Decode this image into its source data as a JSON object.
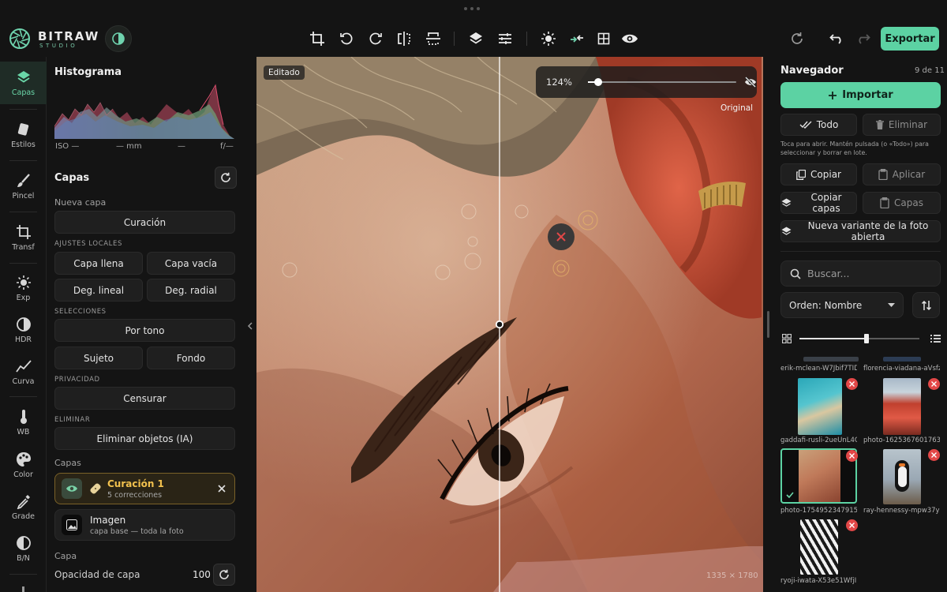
{
  "brand": {
    "name": "BITRAW",
    "sub": "STUDIO"
  },
  "toolbar": {
    "export_label": "Exportar",
    "tools": [
      "crop-icon",
      "rotate-left-icon",
      "rotate-right-icon",
      "flip-horizontal-icon",
      "flip-vertical-icon",
      "layers-icon",
      "adjustments-icon",
      "exposure-icon",
      "compare-icon",
      "grid-icon",
      "eye-icon"
    ],
    "right": [
      "reset-icon",
      "undo-icon",
      "redo-icon"
    ]
  },
  "rail": {
    "items": [
      {
        "label": "Capas",
        "icon": "layers-icon",
        "active": true
      },
      {
        "label": "Estilos",
        "icon": "styles-icon"
      },
      {
        "label": "Pincel",
        "icon": "brush-icon"
      },
      {
        "label": "Transf",
        "icon": "transform-icon"
      },
      {
        "label": "Exp",
        "icon": "exposure-icon"
      },
      {
        "label": "HDR",
        "icon": "hdr-icon"
      },
      {
        "label": "Curva",
        "icon": "curve-icon"
      },
      {
        "label": "WB",
        "icon": "thermometer-icon"
      },
      {
        "label": "Color",
        "icon": "palette-icon"
      },
      {
        "label": "Grade",
        "icon": "eyedropper-icon"
      },
      {
        "label": "B/N",
        "icon": "bw-icon"
      }
    ]
  },
  "left": {
    "histogram_title": "Histograma",
    "meta": {
      "iso": "ISO —",
      "focal": "— mm",
      "shutter": "—",
      "aperture": "f/—"
    },
    "layers_title": "Capas",
    "new_layer_label": "Nueva capa",
    "curation_button": "Curación",
    "local_adjust_label": "AJUSTES LOCALES",
    "full_layer": "Capa llena",
    "empty_layer": "Capa vacía",
    "linear_grad": "Deg. lineal",
    "radial_grad": "Deg. radial",
    "selections_label": "SELECCIONES",
    "by_tone": "Por tono",
    "subject": "Sujeto",
    "background": "Fondo",
    "privacy_label": "PRIVACIDAD",
    "censor": "Censurar",
    "remove_label": "ELIMINAR",
    "remove_ai": "Eliminar objetos (IA)",
    "layers_list_label": "Capas",
    "layers": [
      {
        "name": "Curación 1",
        "sub": "5 correcciones"
      },
      {
        "name": "Imagen",
        "sub": "capa base — toda la foto"
      }
    ],
    "layer_section": "Capa",
    "opacity_label": "Opacidad de capa",
    "opacity_value": "100"
  },
  "canvas": {
    "edited_label": "Editado",
    "original_label": "Original",
    "zoom": "124%",
    "zoom_level": 0.05,
    "dimensions": "1335 × 1780"
  },
  "navigator": {
    "title": "Navegador",
    "count": "9 de 11",
    "import_label": "Importar",
    "all_label": "Todo",
    "delete_label": "Eliminar",
    "hint": "Toca para abrir. Mantén pulsada (o «Todo») para seleccionar y borrar en lote.",
    "copy": "Copiar",
    "apply": "Aplicar",
    "copy_layers": "Copiar capas",
    "layers": "Capas",
    "new_variant": "Nueva variante de la foto abierta",
    "search_placeholder": "Buscar...",
    "sort_label": "Orden: Nombre",
    "thumb_size": 0.54,
    "photos": [
      "erik-mclean-W7Jbif7TID",
      "florencia-viadana-aVsfz6",
      "gaddafi-rusli-2ueUnL4Ck",
      "photo-1625367601763-0",
      "photo-1754952347915-1f",
      "ray-hennessy-mpw37yX",
      "ryoji-iwata-X53e51WfjIE-"
    ]
  },
  "colors": {
    "accent": "#5cd2a3",
    "warning": "#e24747",
    "selected_layer": "#7a6128"
  }
}
